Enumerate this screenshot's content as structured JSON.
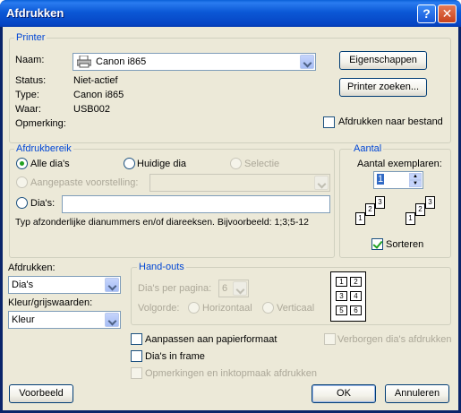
{
  "window": {
    "title": "Afdrukken",
    "help": "?",
    "close": "✕"
  },
  "printer": {
    "group_title": "Printer",
    "name_label": "Naam:",
    "name_value": "Canon i865",
    "properties_button": "Eigenschappen",
    "find_button": "Printer zoeken...",
    "status_label": "Status:",
    "status_value": "Niet-actief",
    "type_label": "Type:",
    "type_value": "Canon i865",
    "where_label": "Waar:",
    "where_value": "USB002",
    "comment_label": "Opmerking:",
    "print_to_file": "Afdrukken naar bestand"
  },
  "range": {
    "group_title": "Afdrukbereik",
    "all": "Alle dia's",
    "current": "Huidige dia",
    "selection": "Selectie",
    "custom_show": "Aangepaste voorstelling:",
    "slides": "Dia's:",
    "hint": "Typ afzonderlijke dianummers en/of diareeksen. Bijvoorbeeld: 1;3;5-12"
  },
  "copies": {
    "group_title": "Aantal",
    "label": "Aantal exemplaren:",
    "value": "1",
    "collate": "Sorteren",
    "pages_a": [
      "1",
      "2",
      "3"
    ],
    "pages_b": [
      "1",
      "2",
      "3"
    ]
  },
  "print_what": {
    "label": "Afdrukken:",
    "value": "Dia's"
  },
  "color": {
    "label": "Kleur/grijswaarden:",
    "value": "Kleur"
  },
  "handouts": {
    "group_title": "Hand-outs",
    "per_page_label": "Dia's per pagina:",
    "per_page_value": "6",
    "order_label": "Volgorde:",
    "horizontal": "Horizontaal",
    "vertical": "Verticaal",
    "preview_cells": [
      "1",
      "2",
      "3",
      "4",
      "5",
      "6"
    ]
  },
  "options": {
    "fit": "Aanpassen aan papierformaat",
    "frame": "Dia's in frame",
    "comments": "Opmerkingen en inktopmaak afdrukken",
    "hidden": "Verborgen dia's afdrukken"
  },
  "buttons": {
    "preview": "Voorbeeld",
    "ok": "OK",
    "cancel": "Annuleren"
  }
}
